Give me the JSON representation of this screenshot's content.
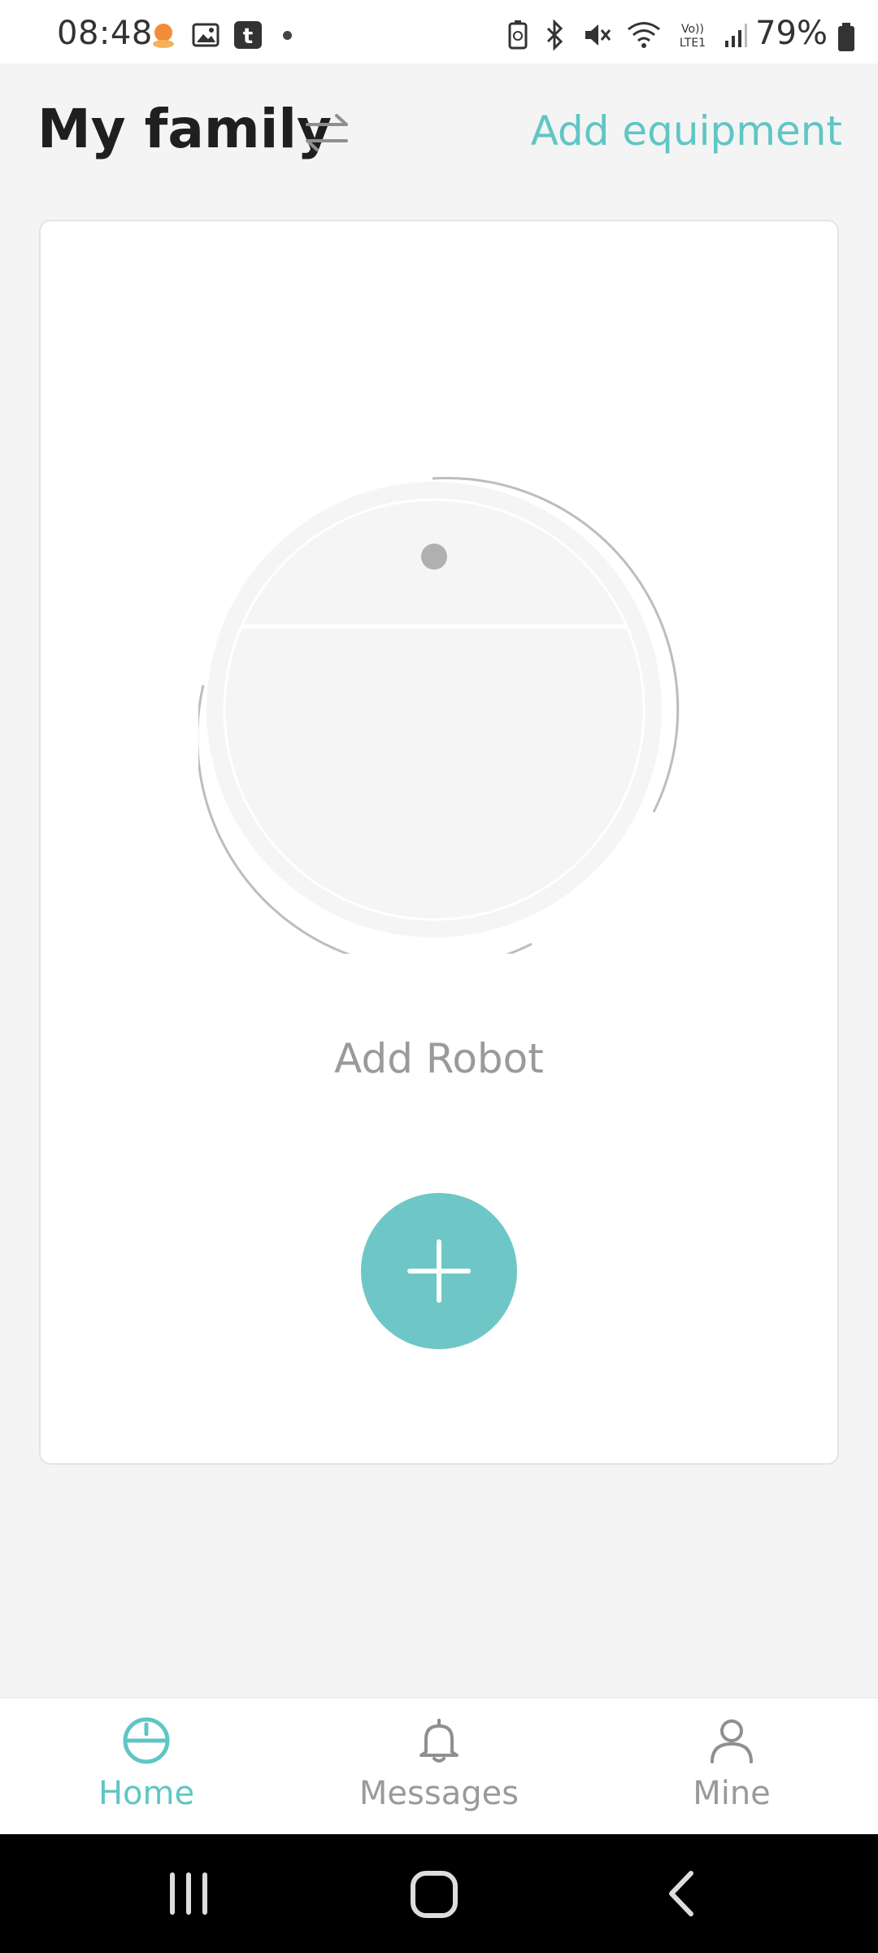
{
  "status_bar": {
    "time": "08:48",
    "battery": "79%",
    "network_label": "Vo)) LTE1",
    "icons_left": [
      "orange-app-icon",
      "gallery-icon",
      "tumblr-icon",
      "dot-icon"
    ],
    "icons_right": [
      "battery-saver-icon",
      "bluetooth-icon",
      "mute-icon",
      "wifi-icon",
      "lte-icon",
      "signal-icon",
      "battery-icon"
    ]
  },
  "header": {
    "title": "My family",
    "add_equipment": "Add equipment"
  },
  "card": {
    "label": "Add Robot"
  },
  "nav": {
    "home": "Home",
    "messages": "Messages",
    "mine": "Mine",
    "active": "Home"
  },
  "colors": {
    "accent": "#5fc6c4",
    "button": "#6ec7c6",
    "background": "#f4f4f4",
    "muted": "#9a9a9a"
  }
}
